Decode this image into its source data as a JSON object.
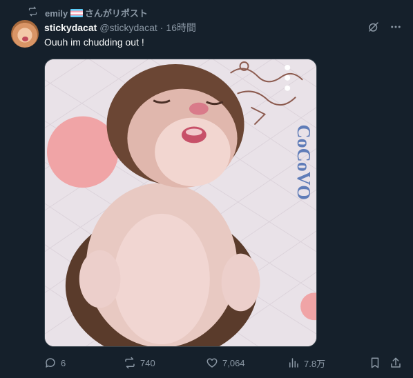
{
  "repost": {
    "icon": "repost-icon",
    "user": "emily",
    "flag": "transgender-flag-emoji",
    "suffix": "さんがリポスト"
  },
  "tweet": {
    "author_name": "stickydacat",
    "handle": "@stickydacat",
    "separator": "·",
    "time": "16時間",
    "text": "Ouuh im chudding out !",
    "media_watermark": "CoCoVO"
  },
  "actions": {
    "replies": "6",
    "reposts": "740",
    "likes": "7,064",
    "views": "7.8万"
  },
  "colors": {
    "background": "#15202b",
    "secondary_text": "#8b98a5",
    "primary_text": "#f7f9f9"
  }
}
